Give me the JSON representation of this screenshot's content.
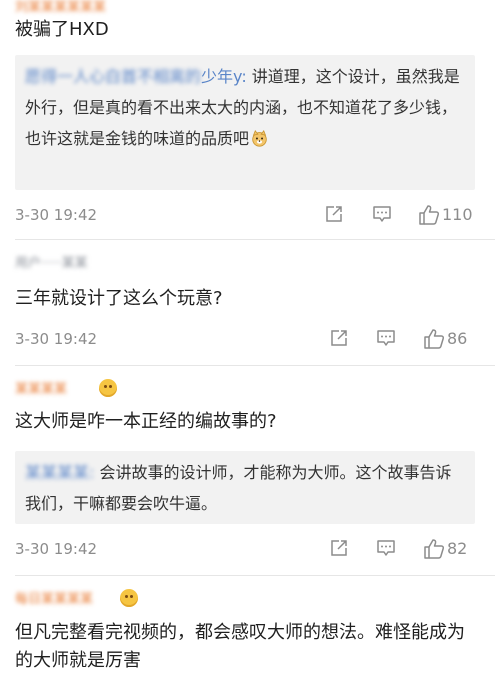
{
  "comments": [
    {
      "username": "刘某某某某某某",
      "text": "被骗了HXD",
      "quote": {
        "user_blurred": "愿得一人心白首不相离的",
        "user_visible": "少年y:",
        "text": " 讲道理，这个设计，虽然我是外行，但是真的看不出来太大的内涵，也不知道花了多少钱，也许这就是金钱的味道的品质吧",
        "emoji": "doge-icon"
      },
      "time": "3-30 19:42",
      "likes": "110"
    },
    {
      "username": "用户·····某某",
      "text": "三年就设计了这么个玩意?",
      "quote": null,
      "time": "3-30 19:42",
      "likes": "86"
    },
    {
      "username": "某某某某",
      "text": "这大师是咋一本正经的编故事的?",
      "quote": {
        "user_blurred": "某某某某:",
        "user_visible": "",
        "text": " 会讲故事的设计师，才能称为大师。这个故事告诉我们，干嘛都要会吹牛逼。",
        "emoji": null
      },
      "time": "3-30 19:42",
      "likes": "82"
    },
    {
      "username": "每日某某某某",
      "text": "但凡完整看完视频的，都会感叹大师的想法。难怪能成为的大师就是厉害",
      "quote": null,
      "time": "",
      "likes": ""
    }
  ],
  "icons": {
    "share": "share-icon",
    "comment": "reply-icon",
    "like": "like-icon"
  },
  "colors": {
    "link": "#5a85c8",
    "meta": "#8c8c8c",
    "quote_bg": "#f2f2f2",
    "divider": "#e6e6e6"
  }
}
